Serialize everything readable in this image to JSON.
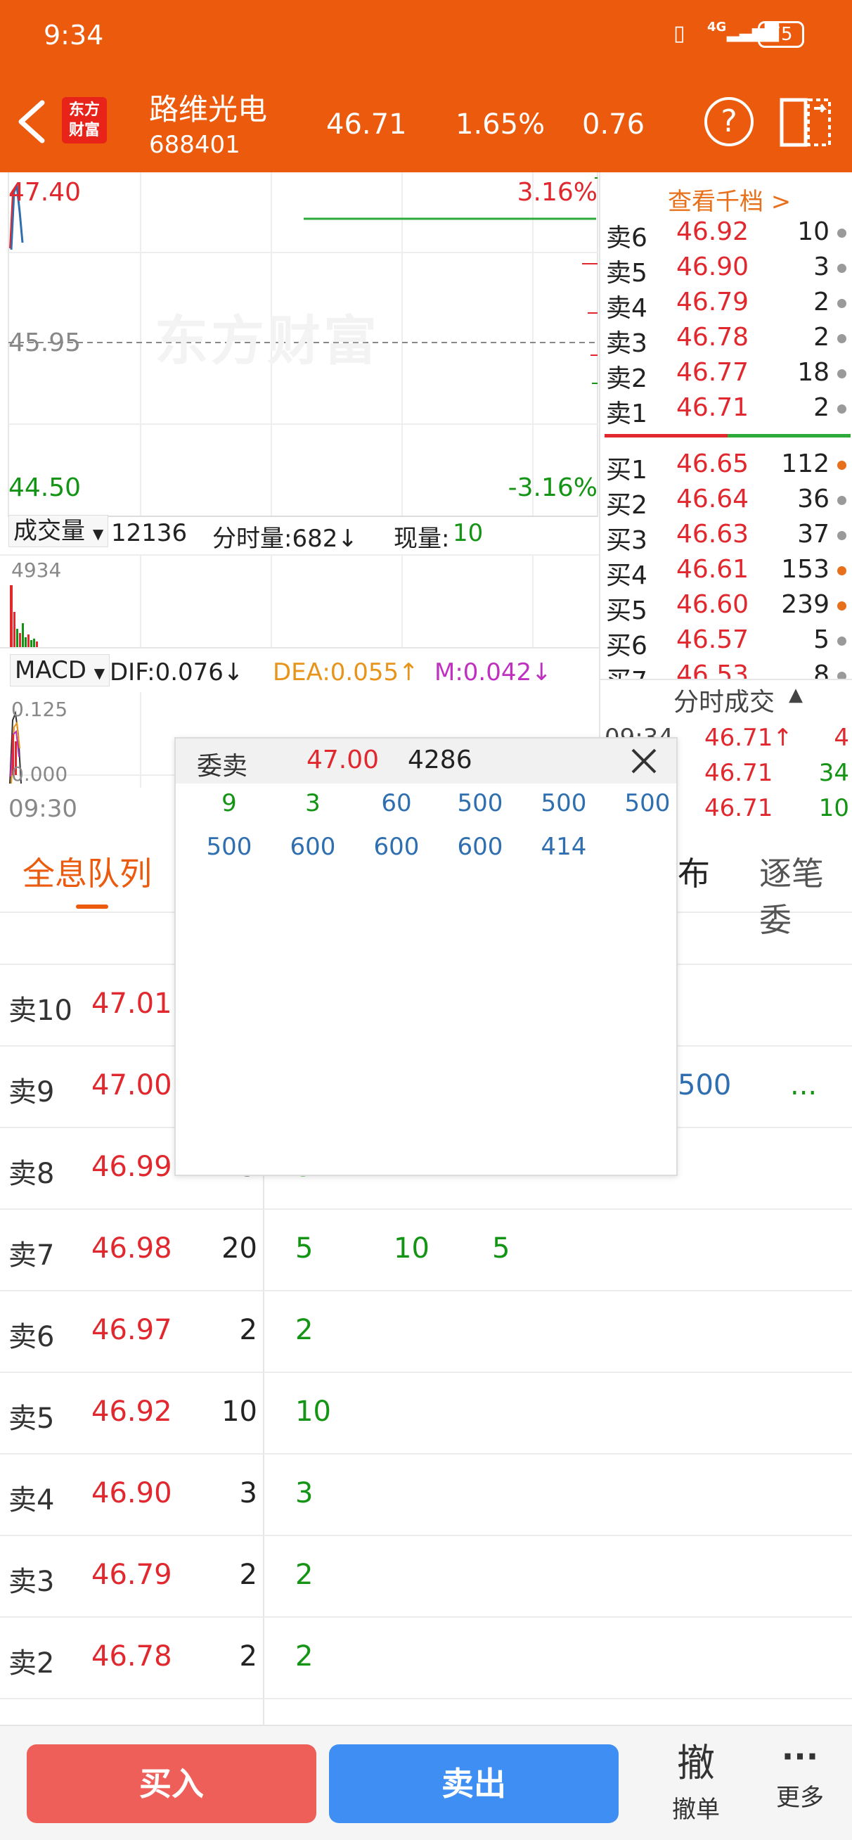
{
  "status": {
    "time": "9:34",
    "network": "4G",
    "battery": "75"
  },
  "header": {
    "logo_line1": "东方",
    "logo_line2": "财富",
    "stock_name": "路维光电",
    "stock_code": "688401",
    "price": "46.71",
    "change_pct": "1.65%",
    "change_amt": "0.76"
  },
  "chart": {
    "price_high": "47.40",
    "price_mid": "45.95",
    "price_low": "44.50",
    "pct_high": "3.16%",
    "pct_low": "-3.16%",
    "watermark": "东方财富",
    "volume_label": "成交量",
    "volume_value": "12136",
    "fenshi_label": "分时量:682↓",
    "xianliang_label": "现量:",
    "xianliang_value": "10",
    "volume_axis": "4934",
    "macd_label": "MACD",
    "dif": "DIF:0.076↓",
    "dea": "DEA:0.055↑",
    "m": "M:0.042↓",
    "macd_top": "0.125",
    "macd_bottom": "0.000",
    "time_start": "09:30"
  },
  "orderbook": {
    "view_thousand": "查看千档 >",
    "asks": [
      {
        "label": "卖6",
        "price": "46.92",
        "vol": "10"
      },
      {
        "label": "卖5",
        "price": "46.90",
        "vol": "3"
      },
      {
        "label": "卖4",
        "price": "46.79",
        "vol": "2"
      },
      {
        "label": "卖3",
        "price": "46.78",
        "vol": "2"
      },
      {
        "label": "卖2",
        "price": "46.77",
        "vol": "18"
      },
      {
        "label": "卖1",
        "price": "46.71",
        "vol": "2"
      }
    ],
    "bids": [
      {
        "label": "买1",
        "price": "46.65",
        "vol": "112"
      },
      {
        "label": "买2",
        "price": "46.64",
        "vol": "36"
      },
      {
        "label": "买3",
        "price": "46.63",
        "vol": "37"
      },
      {
        "label": "买4",
        "price": "46.61",
        "vol": "153"
      },
      {
        "label": "买5",
        "price": "46.60",
        "vol": "239"
      },
      {
        "label": "买6",
        "price": "46.57",
        "vol": "5"
      },
      {
        "label": "买7",
        "price": "46.53",
        "vol": "8"
      }
    ],
    "trades_title": "分时成交",
    "trades": [
      {
        "time": "09:34",
        "price": "46.71↑",
        "vol": "4"
      },
      {
        "time": "",
        "price": "46.71",
        "vol": "34"
      },
      {
        "time": "",
        "price": "46.71",
        "vol": "10"
      }
    ]
  },
  "tabs": {
    "active": "全息队列",
    "t2": "布",
    "t3": "逐笔委"
  },
  "queue_rows": [
    {
      "label": "卖10",
      "price": "47.01",
      "total": "",
      "orders": []
    },
    {
      "label": "卖9",
      "price": "47.00",
      "total": "",
      "orders": [
        "500",
        "..."
      ]
    },
    {
      "label": "卖8",
      "price": "46.99",
      "total": "3",
      "orders": [
        "3"
      ]
    },
    {
      "label": "卖7",
      "price": "46.98",
      "total": "20",
      "orders": [
        "5",
        "10",
        "5"
      ]
    },
    {
      "label": "卖6",
      "price": "46.97",
      "total": "2",
      "orders": [
        "2"
      ]
    },
    {
      "label": "卖5",
      "price": "46.92",
      "total": "10",
      "orders": [
        "10"
      ]
    },
    {
      "label": "卖4",
      "price": "46.90",
      "total": "3",
      "orders": [
        "3"
      ]
    },
    {
      "label": "卖3",
      "price": "46.79",
      "total": "2",
      "orders": [
        "2"
      ]
    },
    {
      "label": "卖2",
      "price": "46.78",
      "total": "2",
      "orders": [
        "2"
      ]
    }
  ],
  "popup": {
    "title": "委卖",
    "price": "47.00",
    "total": "4286",
    "orders_row1": [
      "9",
      "3",
      "60",
      "500",
      "500",
      "500"
    ],
    "orders_row2": [
      "500",
      "600",
      "600",
      "600",
      "414"
    ]
  },
  "bottom": {
    "buy": "买入",
    "sell": "卖出",
    "cancel_glyph": "撤",
    "cancel_label": "撤单",
    "more_glyph": "···",
    "more_label": "更多"
  }
}
